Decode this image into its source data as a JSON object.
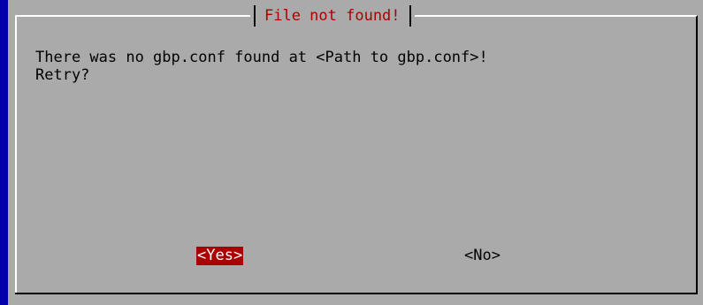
{
  "dialog": {
    "title": "File not found!",
    "message_lines": [
      "There was no gbp.conf found at <Path to gbp.conf>!",
      "Retry?"
    ],
    "buttons": {
      "yes_label": "<Yes>",
      "no_label": "<No>"
    },
    "colors": {
      "screen_background": "#0000aa",
      "dialog_background": "#aaaaaa",
      "title_text": "#aa0000",
      "selected_button_background": "#aa0000",
      "selected_button_text": "#ffffff",
      "body_text": "#000000"
    },
    "selected_button": "yes"
  }
}
